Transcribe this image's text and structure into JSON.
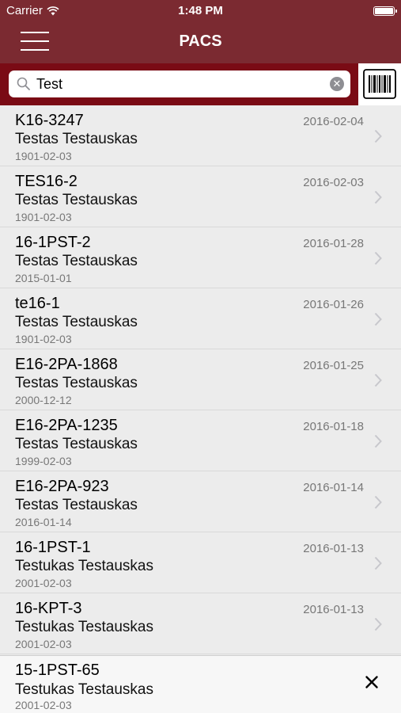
{
  "status_bar": {
    "carrier": "Carrier",
    "time": "1:48 PM"
  },
  "nav": {
    "title": "PACS"
  },
  "search": {
    "value": "Test"
  },
  "studies": [
    {
      "accession": "K16-3247",
      "patient": "Testas Testauskas",
      "birthdate": "1901-02-03",
      "study_date": "2016-02-04"
    },
    {
      "accession": "TES16-2",
      "patient": "Testas Testauskas",
      "birthdate": "1901-02-03",
      "study_date": "2016-02-03"
    },
    {
      "accession": "16-1PST-2",
      "patient": "Testas Testauskas",
      "birthdate": "2015-01-01",
      "study_date": "2016-01-28"
    },
    {
      "accession": "te16-1",
      "patient": "Testas Testauskas",
      "birthdate": "1901-02-03",
      "study_date": "2016-01-26"
    },
    {
      "accession": "E16-2PA-1868",
      "patient": "Testas Testauskas",
      "birthdate": "2000-12-12",
      "study_date": "2016-01-25"
    },
    {
      "accession": "E16-2PA-1235",
      "patient": "Testas Testauskas",
      "birthdate": "1999-02-03",
      "study_date": "2016-01-18"
    },
    {
      "accession": "E16-2PA-923",
      "patient": "Testas Testauskas",
      "birthdate": "2016-01-14",
      "study_date": "2016-01-14"
    },
    {
      "accession": "16-1PST-1",
      "patient": "Testukas Testauskas",
      "birthdate": "2001-02-03",
      "study_date": "2016-01-13"
    },
    {
      "accession": "16-KPT-3",
      "patient": "Testukas Testauskas",
      "birthdate": "2001-02-03",
      "study_date": "2016-01-13"
    }
  ],
  "selected_study": {
    "accession": "15-1PST-65",
    "patient": "Testukas Testauskas",
    "birthdate": "2001-02-03"
  },
  "colors": {
    "nav_bg": "#7b2a31",
    "search_bg": "#7a0b15",
    "list_bg": "#ececec"
  },
  "icons": [
    "wifi-icon",
    "battery-icon",
    "menu-icon",
    "search-icon",
    "clear-icon",
    "barcode-icon",
    "chevron-right-icon",
    "close-icon"
  ]
}
